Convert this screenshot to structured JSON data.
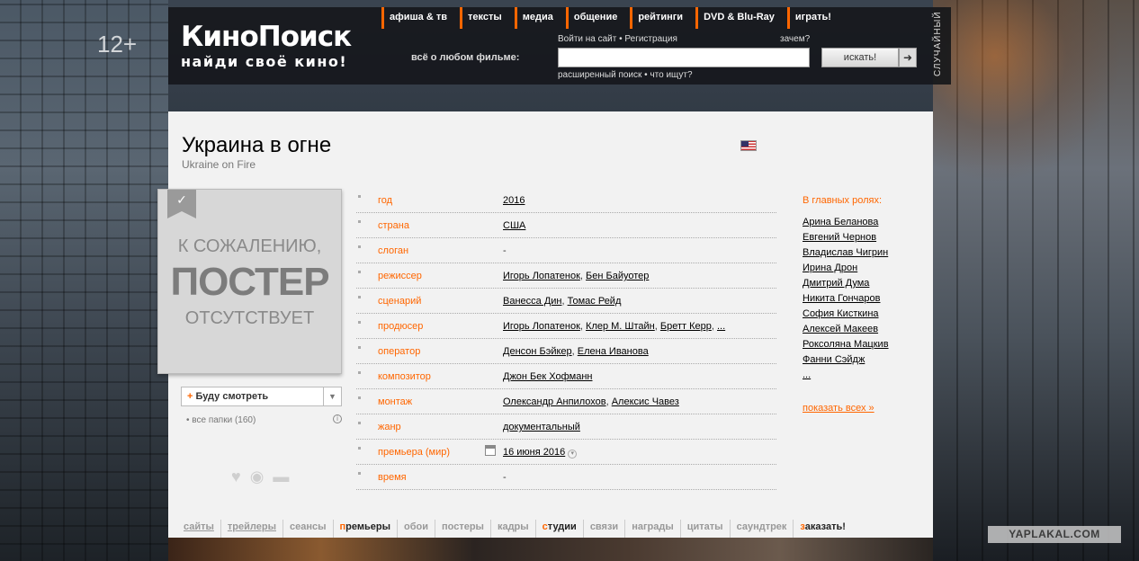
{
  "age_rating": "12+",
  "header": {
    "logo": "КиноПоиск",
    "slogan": "найди своё кино!",
    "nav": [
      "афиша & тв",
      "тексты",
      "медиа",
      "общение",
      "рейтинги",
      "DVD & Blu-Ray",
      "играть!"
    ],
    "tagline": "всё о любом фильме:",
    "login": "Войти на сайт • Регистрация",
    "why": "зачем?",
    "search_placeholder": "",
    "search_button": "искать!",
    "search_go_icon": "arrow-right-icon",
    "advanced": "расширенный поиск • что ищут?",
    "random": "СЛУЧАЙНЫЙ"
  },
  "film": {
    "title": "Украина в огне",
    "original_title": "Ukraine on Fire",
    "flag": "us-flag-icon"
  },
  "poster": {
    "line1": "К СОЖАЛЕНИЮ,",
    "line2": "ПОСТЕР",
    "line3": "ОТСУТСТВУЕТ",
    "bookmark_icon": "check-icon"
  },
  "watch": {
    "plus": "+",
    "label": "Буду смотреть",
    "folders": "• все папки (160)",
    "info_icon": "i"
  },
  "social": {
    "icons": [
      "heart-icon",
      "eye-icon",
      "comment-icon"
    ]
  },
  "info": [
    {
      "label": "год",
      "value": "2016",
      "link": true
    },
    {
      "label": "страна",
      "value": "США",
      "link": true
    },
    {
      "label": "слоган",
      "value": "-",
      "link": false
    },
    {
      "label": "режиссер",
      "links": [
        "Игорь Лопатенок",
        "Бен Байуотер"
      ]
    },
    {
      "label": "сценарий",
      "links": [
        "Ванесса Дин",
        "Томас Рейд"
      ]
    },
    {
      "label": "продюсер",
      "links": [
        "Игорь Лопатенок",
        "Клер М. Штайн",
        "Бретт Керр",
        "..."
      ]
    },
    {
      "label": "оператор",
      "links": [
        "Денсон Бэйкер",
        "Елена Иванова"
      ]
    },
    {
      "label": "композитор",
      "links": [
        "Джон Бек Хофманн"
      ]
    },
    {
      "label": "монтаж",
      "links": [
        "Олександр Анпилохов",
        "Алексис Чавез"
      ]
    },
    {
      "label": "жанр",
      "links": [
        "документальный"
      ]
    },
    {
      "label": "премьера (мир)",
      "links": [
        "16 июня 2016"
      ],
      "calendar": true
    },
    {
      "label": "время",
      "value": "-",
      "link": false
    }
  ],
  "cast": {
    "heading": "В главных ролях:",
    "actors": [
      "Арина Беланова",
      "Евгений Чернов",
      "Владислав Чигрин",
      "Ирина Дрон",
      "Дмитрий Дума",
      "Никита Гончаров",
      "София Кисткина",
      "Алексей Макеев",
      "Роксоляна Мацкив",
      "Фанни Сэйдж",
      "..."
    ],
    "show_all": "показать всех »"
  },
  "tabs": [
    {
      "label": "сайты",
      "style": "link"
    },
    {
      "label": "трейлеры",
      "style": "link"
    },
    {
      "label": "сеансы",
      "style": "plain"
    },
    {
      "label": "премьеры",
      "style": "hl1"
    },
    {
      "label": "обои",
      "style": "plain"
    },
    {
      "label": "постеры",
      "style": "plain"
    },
    {
      "label": "кадры",
      "style": "plain"
    },
    {
      "label": "студии",
      "style": "hl1"
    },
    {
      "label": "связи",
      "style": "plain"
    },
    {
      "label": "награды",
      "style": "plain"
    },
    {
      "label": "цитаты",
      "style": "plain"
    },
    {
      "label": "саундтрек",
      "style": "plain"
    },
    {
      "label": "заказать!",
      "style": "hl1"
    }
  ],
  "watermark": "YAPLAKAL.COM"
}
